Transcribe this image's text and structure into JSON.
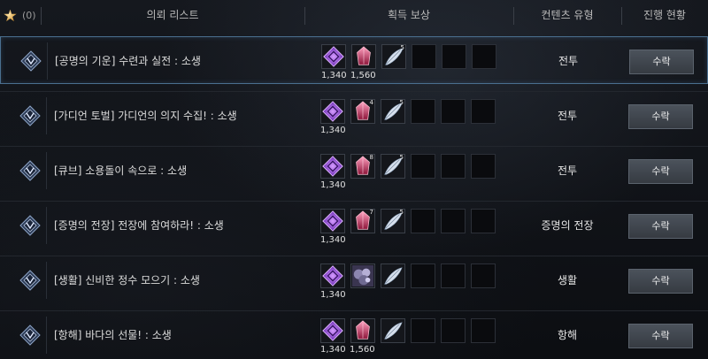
{
  "header": {
    "favorite_count": "(0)",
    "col_quest_list": "의뢰 리스트",
    "col_rewards": "획득 보상",
    "col_content_type": "컨텐츠 유형",
    "col_progress": "진행 현황"
  },
  "colors": {
    "accent_selected": "#4a6f8f",
    "button_bg": "#434950",
    "purple_gem": "#7a2fd0",
    "pink_crystal": "#d23a6a"
  },
  "quests": [
    {
      "title": "[공명의 기운] 수련과 실전 : 소생",
      "content_type": "전투",
      "button": "수락",
      "selected": true,
      "rewards": [
        {
          "icon": "purple-gem-icon",
          "label": "1,340",
          "qty": ""
        },
        {
          "icon": "pink-crystal-icon",
          "label": "1,560",
          "qty": ""
        },
        {
          "icon": "feather-icon",
          "label": "",
          "qty": "5"
        }
      ]
    },
    {
      "title": "[가디언 토벌] 가디언의 의지 수집! : 소생",
      "content_type": "전투",
      "button": "수락",
      "selected": false,
      "rewards": [
        {
          "icon": "purple-gem-icon",
          "label": "1,340",
          "qty": ""
        },
        {
          "icon": "pink-crystal-icon",
          "label": "",
          "qty": "4"
        },
        {
          "icon": "feather-icon",
          "label": "",
          "qty": "5"
        }
      ]
    },
    {
      "title": "[큐브] 소용돌이 속으로 : 소생",
      "content_type": "전투",
      "button": "수락",
      "selected": false,
      "rewards": [
        {
          "icon": "purple-gem-icon",
          "label": "1,340",
          "qty": ""
        },
        {
          "icon": "pink-crystal-icon",
          "label": "",
          "qty": "8"
        },
        {
          "icon": "feather-icon",
          "label": "",
          "qty": "5"
        }
      ]
    },
    {
      "title": "[증명의 전장] 전장에 참여하라! : 소생",
      "content_type": "증명의 전장",
      "button": "수락",
      "selected": false,
      "rewards": [
        {
          "icon": "purple-gem-icon",
          "label": "1,340",
          "qty": ""
        },
        {
          "icon": "pink-crystal-icon",
          "label": "",
          "qty": "7"
        },
        {
          "icon": "feather-icon",
          "label": "",
          "qty": "5"
        }
      ]
    },
    {
      "title": "[생활] 신비한 정수 모으기 : 소생",
      "content_type": "생활",
      "button": "수락",
      "selected": false,
      "rewards": [
        {
          "icon": "purple-gem-icon",
          "label": "1,340",
          "qty": ""
        },
        {
          "icon": "ore-cluster-icon",
          "label": "",
          "qty": ""
        },
        {
          "icon": "feather-icon",
          "label": "",
          "qty": ""
        }
      ]
    },
    {
      "title": "[항해] 바다의 선물! : 소생",
      "content_type": "항해",
      "button": "수락",
      "selected": false,
      "rewards": [
        {
          "icon": "purple-gem-icon",
          "label": "1,340",
          "qty": ""
        },
        {
          "icon": "pink-crystal-icon",
          "label": "1,560",
          "qty": ""
        },
        {
          "icon": "feather-icon",
          "label": "",
          "qty": ""
        }
      ]
    }
  ]
}
